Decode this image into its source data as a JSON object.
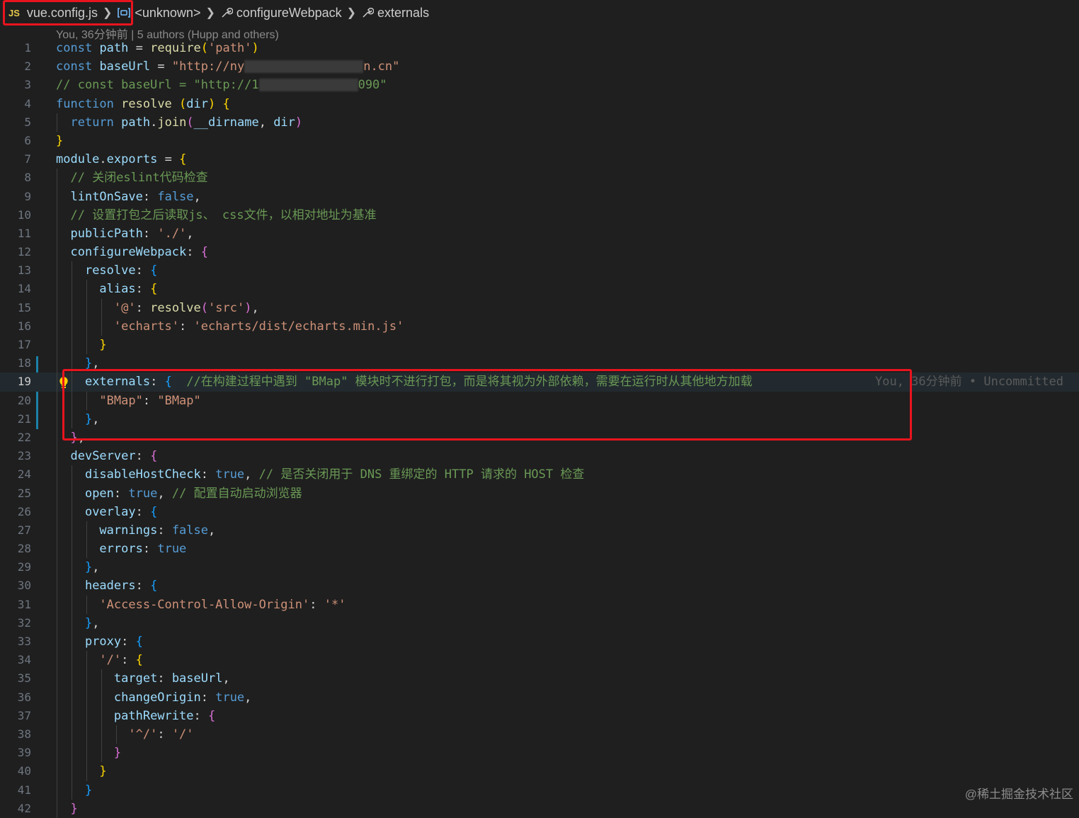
{
  "breadcrumb": {
    "file_badge": "JS",
    "file": "vue.config.js",
    "symbol1": "<unknown>",
    "symbol2": "configureWebpack",
    "symbol3": "externals"
  },
  "blame_header": "You, 36分钟前 | 5 authors (Hupp and others)",
  "blame_inline": "You, 36分钟前 • Uncommitted",
  "watermark": "@稀土掘金技术社区",
  "colors": {
    "highlight_box": "#e8141e",
    "git_modified_bar": "#1b81a8",
    "editor_background": "#1f1f1f"
  },
  "code": {
    "l1": {
      "no": "1",
      "t1": "const",
      "t2": "path",
      "t3": "=",
      "t4": "require",
      "t5": "(",
      "t6": "'path'",
      "t7": ")"
    },
    "l2": {
      "no": "2",
      "t1": "const",
      "t2": "baseUrl",
      "t3": "=",
      "t4": "\"http://ny",
      "t5": "n.cn\""
    },
    "l3": {
      "no": "3",
      "t1": "// const baseUrl = \"http://1",
      "t2": "090\""
    },
    "l4": {
      "no": "4",
      "t1": "function",
      "t2": "resolve",
      "t3": "(",
      "t4": "dir",
      "t5": ")",
      "t6": "{"
    },
    "l5": {
      "no": "5",
      "t1": "return",
      "t2": "path",
      "t3": ".",
      "t4": "join",
      "t5": "(",
      "t6": "__dirname",
      "t7": ",",
      "t8": "dir",
      "t9": ")"
    },
    "l6": {
      "no": "6",
      "t1": "}"
    },
    "l7": {
      "no": "7",
      "t1": "module",
      "t2": ".",
      "t3": "exports",
      "t4": "=",
      "t5": "{"
    },
    "l8": {
      "no": "8",
      "t1": "// 关闭eslint代码检查"
    },
    "l9": {
      "no": "9",
      "t1": "lintOnSave",
      "t2": ":",
      "t3": "false",
      "t4": ","
    },
    "l10": {
      "no": "10",
      "t1": "// 设置打包之后读取js、 css文件，以相对地址为基准"
    },
    "l11": {
      "no": "11",
      "t1": "publicPath",
      "t2": ":",
      "t3": "'./'",
      "t4": ","
    },
    "l12": {
      "no": "12",
      "t1": "configureWebpack",
      "t2": ":",
      "t3": "{"
    },
    "l13": {
      "no": "13",
      "t1": "resolve",
      "t2": ":",
      "t3": "{"
    },
    "l14": {
      "no": "14",
      "t1": "alias",
      "t2": ":",
      "t3": "{"
    },
    "l15": {
      "no": "15",
      "t1": "'@'",
      "t2": ":",
      "t3": "resolve",
      "t4": "(",
      "t5": "'src'",
      "t6": ")",
      "t7": ","
    },
    "l16": {
      "no": "16",
      "t1": "'echarts'",
      "t2": ":",
      "t3": "'echarts/dist/echarts.min.js'"
    },
    "l17": {
      "no": "17",
      "t1": "}"
    },
    "l18": {
      "no": "18",
      "t1": "}",
      "t2": ","
    },
    "l19": {
      "no": "19",
      "t1": "externals",
      "t2": ":",
      "t3": "{",
      "t4": "//在构建过程中遇到 \"BMap\" 模块时不进行打包，而是将其视为外部依赖，需要在运行时从其他地方加载"
    },
    "l20": {
      "no": "20",
      "t1": "\"BMap\"",
      "t2": ":",
      "t3": "\"BMap\""
    },
    "l21": {
      "no": "21",
      "t1": "}",
      "t2": ","
    },
    "l22": {
      "no": "22",
      "t1": "}",
      "t2": ","
    },
    "l23": {
      "no": "23",
      "t1": "devServer",
      "t2": ":",
      "t3": "{"
    },
    "l24": {
      "no": "24",
      "t1": "disableHostCheck",
      "t2": ":",
      "t3": "true",
      "t4": ",",
      "t5": "// 是否关闭用于 DNS 重绑定的 HTTP 请求的 HOST 检查"
    },
    "l25": {
      "no": "25",
      "t1": "open",
      "t2": ":",
      "t3": "true",
      "t4": ",",
      "t5": "// 配置自动启动浏览器"
    },
    "l26": {
      "no": "26",
      "t1": "overlay",
      "t2": ":",
      "t3": "{"
    },
    "l27": {
      "no": "27",
      "t1": "warnings",
      "t2": ":",
      "t3": "false",
      "t4": ","
    },
    "l28": {
      "no": "28",
      "t1": "errors",
      "t2": ":",
      "t3": "true"
    },
    "l29": {
      "no": "29",
      "t1": "}",
      "t2": ","
    },
    "l30": {
      "no": "30",
      "t1": "headers",
      "t2": ":",
      "t3": "{"
    },
    "l31": {
      "no": "31",
      "t1": "'Access-Control-Allow-Origin'",
      "t2": ":",
      "t3": "'*'"
    },
    "l32": {
      "no": "32",
      "t1": "}",
      "t2": ","
    },
    "l33": {
      "no": "33",
      "t1": "proxy",
      "t2": ":",
      "t3": "{"
    },
    "l34": {
      "no": "34",
      "t1": "'/'",
      "t2": ":",
      "t3": "{"
    },
    "l35": {
      "no": "35",
      "t1": "target",
      "t2": ":",
      "t3": "baseUrl",
      "t4": ","
    },
    "l36": {
      "no": "36",
      "t1": "changeOrigin",
      "t2": ":",
      "t3": "true",
      "t4": ","
    },
    "l37": {
      "no": "37",
      "t1": "pathRewrite",
      "t2": ":",
      "t3": "{"
    },
    "l38": {
      "no": "38",
      "t1": "'^/'",
      "t2": ":",
      "t3": "'/'"
    },
    "l39": {
      "no": "39",
      "t1": "}"
    },
    "l40": {
      "no": "40",
      "t1": "}"
    },
    "l41": {
      "no": "41",
      "t1": "}"
    },
    "l42": {
      "no": "42",
      "t1": "}"
    }
  }
}
